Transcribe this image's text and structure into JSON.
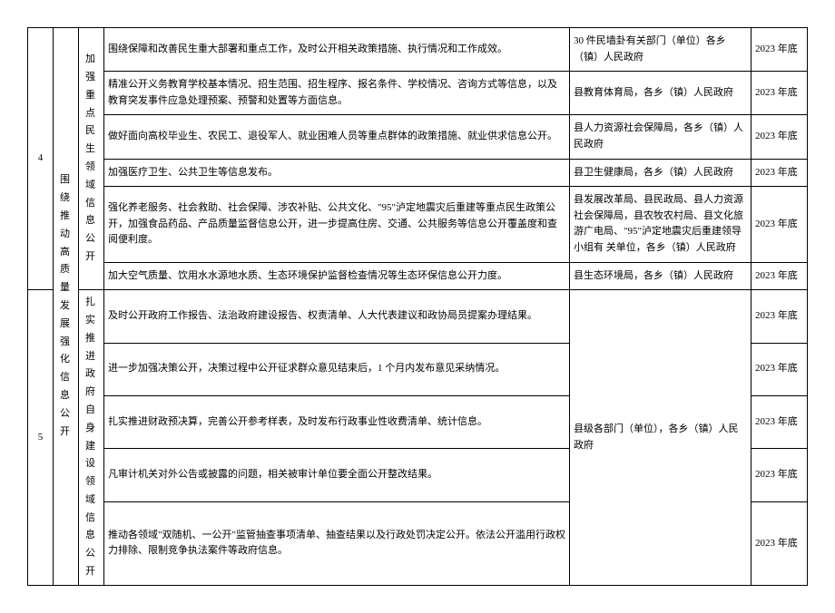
{
  "section1": {
    "index": "4",
    "category": "围绕推动高质量发展强化信息公开",
    "subcategory": "加强重点民生领域信息公开",
    "rows": [
      {
        "content": "围绕保障和改善民生重大部署和重点工作，及时公开相关政策措施、执行情况和工作成效。",
        "dept": "30 件民墙卦有关部门（单位）各乡（镇）人民政府",
        "deadline": "2023 年底"
      },
      {
        "content": "精准公开义务教育学校基本情况、招生范围、招生程序、报名条件、学校情况、咨询方式等信息，以及教育突发事件应急处理预案、预警和处置等方面信息。",
        "dept": "县教育体育局，各乡（镇）人民政府",
        "deadline": "2023 年底"
      },
      {
        "content": "做好面向高校毕业生、农民工、退役军人、就业困难人员等重点群体的政策措施、就业供求信息公开。",
        "dept": "县人力资源社会保障局，各乡（镇）人民政府",
        "deadline": "2023 年底"
      },
      {
        "content": "加强医疗卫生、公共卫生等信息发布。",
        "dept": "县卫生健康局，各乡（镇）人民政府",
        "deadline": "2023 年底"
      },
      {
        "content": "强化养老服务、社会救助、社会保障、涉农补贴、公共文化、\"95\"泸定地震灾后重建等重点民生政策公开，加强食品药品、产品质量监督信息公开，进一步提高住房、交通、公共服务等信息公开覆盖度和查阅便利度。",
        "dept": "县发展改革局、县民政局、县人力资源社会保障局，县农牧农村局、县文化旅游广电局、\"95\"泸定地震灾后重建领导小组有\n关单位，各乡（镇）人民政府",
        "deadline": "2023 年底"
      },
      {
        "content": "加大空气质量、饮用水水源地水质、生态环境保护监督检查情况等生态环保信息公开力度。",
        "dept": "县生态环境局，各乡（镇）人民政府",
        "deadline": "2023 年底"
      }
    ]
  },
  "section2": {
    "index": "5",
    "subcategory": "扎实推进政府自身建设领域信息公开",
    "rows": [
      {
        "content": "及时公开政府工作报告、法治政府建设报告、权责清单、人大代表建议和政协局员提案办理结果。",
        "deadline": "2023 年底"
      },
      {
        "content": "进一步加强决策公开，决策过程中公开征求群众意见结束后，1 个月内发布意见采纳情况。",
        "deadline": "2023 年底"
      },
      {
        "content": "扎实推进财政预决算，完善公开参考样表，及时发布行政事业性收费清单、统计信息。",
        "deadline": "2023 年底"
      },
      {
        "content": "凡审计机关对外公告或披露的问题，相关被审计单位要全面公开整改结果。",
        "deadline": "2023 年底"
      },
      {
        "content": "推动各领域\"双随机、一公开\"监管抽查事项清单、抽查结果以及行政处罚决定公开。依法公开滥用行政权力排除、限制竞争执法案件等政府信息。",
        "deadline": "2023 年底"
      }
    ],
    "dept_merged": "县级各部门（单位），各乡（镇）人民政府"
  }
}
